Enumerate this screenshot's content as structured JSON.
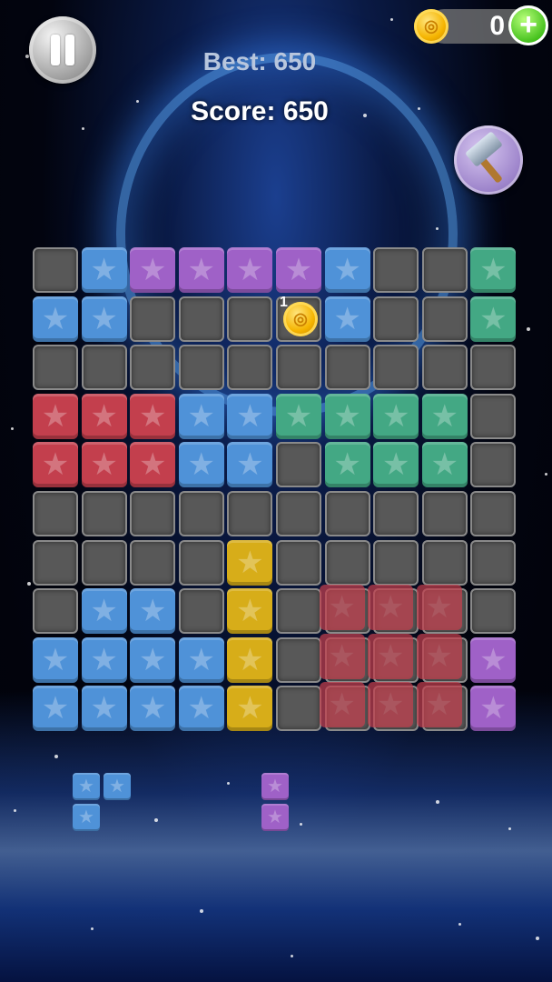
{
  "header": {
    "best_text": "Best: 650",
    "score_text": "Score: 650",
    "coin_count": "0",
    "add_coins_symbol": "+",
    "pause_icon": "pause-icon",
    "hammer_icon": "hammer-icon",
    "coin_icon": "coin-icon"
  },
  "board": {
    "columns": 10,
    "rows": 10,
    "field_coin_label": "1",
    "field_coin": {
      "row": 1,
      "col": 5
    },
    "palette": {
      "blue": "#4f92d8",
      "purple": "#9f61c7",
      "green": "#43a884",
      "red": "#c33f4d",
      "yellow": "#d7ad19",
      "empty": "#585858"
    },
    "grid": [
      [
        "E",
        "B",
        "P",
        "P",
        "P",
        "P",
        "B",
        "E",
        "E",
        "G"
      ],
      [
        "B",
        "B",
        "E",
        "E",
        "E",
        "E",
        "B",
        "E",
        "E",
        "G"
      ],
      [
        "E",
        "E",
        "E",
        "E",
        "E",
        "E",
        "E",
        "E",
        "E",
        "E"
      ],
      [
        "R",
        "R",
        "R",
        "B",
        "B",
        "G",
        "G",
        "G",
        "G",
        "E"
      ],
      [
        "R",
        "R",
        "R",
        "B",
        "B",
        "E",
        "G",
        "G",
        "G",
        "E"
      ],
      [
        "E",
        "E",
        "E",
        "E",
        "E",
        "E",
        "E",
        "E",
        "E",
        "E"
      ],
      [
        "E",
        "E",
        "E",
        "E",
        "Y",
        "E",
        "E",
        "E",
        "E",
        "E"
      ],
      [
        "E",
        "B",
        "B",
        "E",
        "Y",
        "E",
        "E",
        "E",
        "E",
        "E"
      ],
      [
        "B",
        "B",
        "B",
        "B",
        "Y",
        "E",
        "E",
        "E",
        "E",
        "P"
      ],
      [
        "B",
        "B",
        "B",
        "B",
        "Y",
        "E",
        "E",
        "E",
        "E",
        "P"
      ]
    ],
    "drag_preview": {
      "color": "red",
      "cells": [
        [
          7,
          6
        ],
        [
          7,
          7
        ],
        [
          7,
          8
        ],
        [
          8,
          6
        ],
        [
          8,
          7
        ],
        [
          8,
          8
        ],
        [
          9,
          6
        ],
        [
          9,
          7
        ],
        [
          9,
          8
        ]
      ]
    }
  },
  "tray": {
    "pieces": [
      {
        "color": "blue",
        "cells": [
          [
            0,
            0
          ],
          [
            0,
            1
          ],
          [
            1,
            0
          ]
        ]
      },
      {
        "color": "purple",
        "cells": [
          [
            0,
            0
          ],
          [
            1,
            0
          ]
        ]
      }
    ]
  }
}
